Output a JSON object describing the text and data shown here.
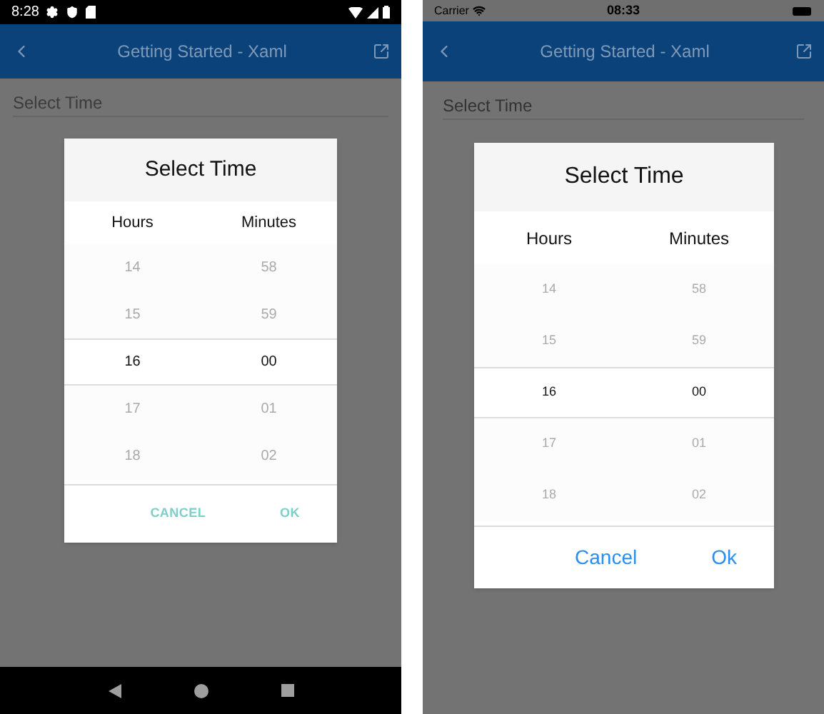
{
  "phones": [
    {
      "kind": "android",
      "status_bar": {
        "time": "8:28"
      },
      "toolbar": {
        "title": "Getting Started - Xaml"
      },
      "field": {
        "placeholder": "Select Time"
      },
      "dialog": {
        "title": "Select Time",
        "columns": [
          "Hours",
          "Minutes"
        ],
        "rows": [
          {
            "hour": "14",
            "minute": "58",
            "selected": false
          },
          {
            "hour": "15",
            "minute": "59",
            "selected": false
          },
          {
            "hour": "16",
            "minute": "00",
            "selected": true
          },
          {
            "hour": "17",
            "minute": "01",
            "selected": false
          },
          {
            "hour": "18",
            "minute": "02",
            "selected": false
          }
        ],
        "buttons": [
          "CANCEL",
          "OK"
        ]
      }
    },
    {
      "kind": "ios",
      "status_bar": {
        "carrier": "Carrier",
        "time": "08:33"
      },
      "toolbar": {
        "title": "Getting Started - Xaml"
      },
      "field": {
        "placeholder": "Select Time"
      },
      "dialog": {
        "title": "Select Time",
        "columns": [
          "Hours",
          "Minutes"
        ],
        "rows": [
          {
            "hour": "14",
            "minute": "58",
            "selected": false
          },
          {
            "hour": "15",
            "minute": "59",
            "selected": false
          },
          {
            "hour": "16",
            "minute": "00",
            "selected": true
          },
          {
            "hour": "17",
            "minute": "01",
            "selected": false
          },
          {
            "hour": "18",
            "minute": "02",
            "selected": false
          }
        ],
        "buttons": [
          "Cancel",
          "Ok"
        ]
      }
    }
  ]
}
